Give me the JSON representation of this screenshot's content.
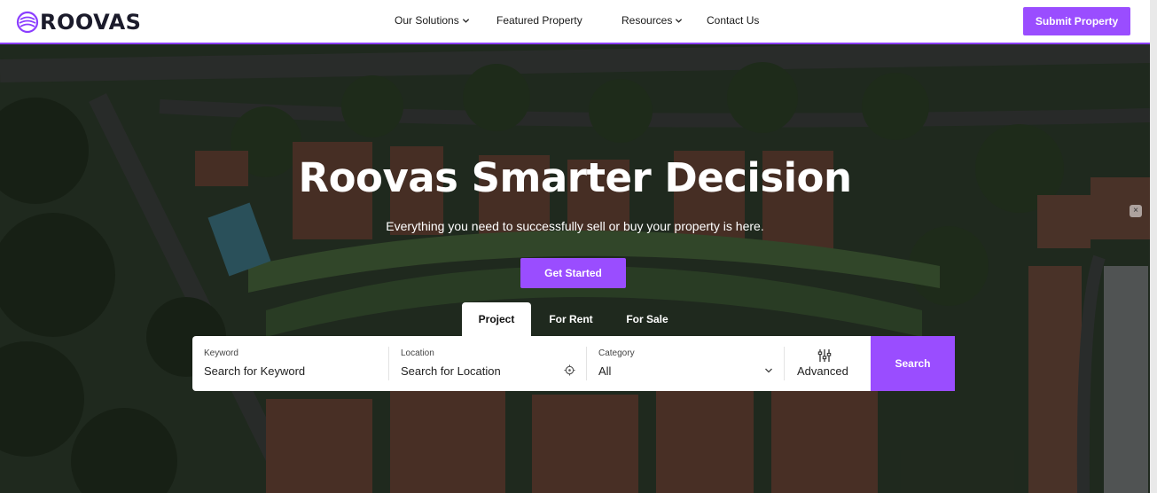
{
  "brand": {
    "name": "ROOVAS",
    "accent": "#9a4dff"
  },
  "nav": {
    "items": [
      {
        "label": "Our Solutions",
        "has_dropdown": true
      },
      {
        "label": "Featured Property",
        "has_dropdown": false
      },
      {
        "label": "Resources",
        "has_dropdown": true
      },
      {
        "label": "Contact Us",
        "has_dropdown": false
      }
    ],
    "cta_label": "Submit Property"
  },
  "hero": {
    "title": "Roovas Smarter Decision",
    "subtitle": "Everything you need to successfully sell or buy your property is here.",
    "cta_label": "Get Started",
    "background": "aerial-neighborhood-image"
  },
  "tabs": [
    {
      "label": "Project",
      "active": true
    },
    {
      "label": "For Rent",
      "active": false
    },
    {
      "label": "For Sale",
      "active": false
    }
  ],
  "search": {
    "keyword": {
      "label": "Keyword",
      "placeholder": "Search for Keyword"
    },
    "location": {
      "label": "Location",
      "placeholder": "Search for Location",
      "icon": "crosshair-icon"
    },
    "category": {
      "label": "Category",
      "value": "All",
      "icon": "chevron-down-icon"
    },
    "advanced": {
      "label": "Advanced",
      "icon": "sliders-icon"
    },
    "button_label": "Search"
  },
  "overlay_close": "×"
}
